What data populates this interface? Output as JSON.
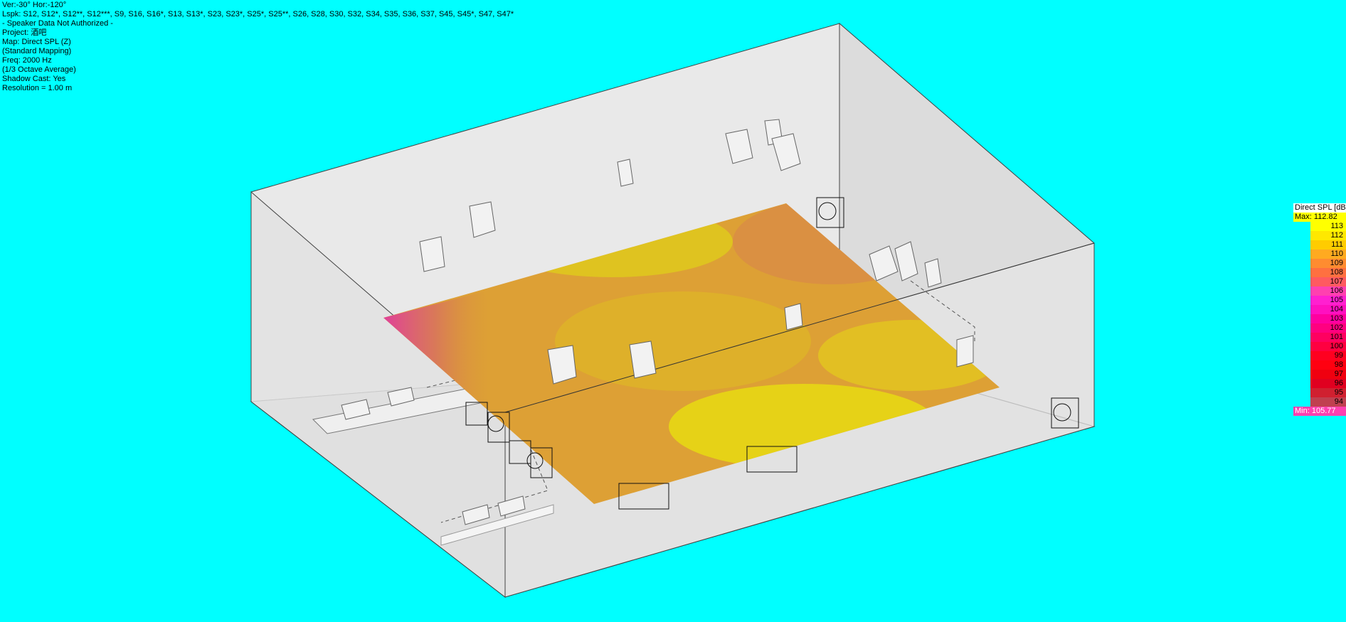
{
  "info": {
    "angles": "Ver:-30°   Hor:-120°",
    "loudspeakers": "Lspk: S12, S12*, S12**, S12***, S9, S16, S16*, S13, S13*, S23, S23*, S25*, S25**, S26, S28, S30, S32, S34, S35, S36, S37, S45, S45*, S47, S47*",
    "authorization": "- Speaker Data Not Authorized -",
    "project": "Project: 酒吧",
    "map": "Map: Direct SPL (Z)",
    "mapping": "(Standard Mapping)",
    "frequency": "Freq: 2000 Hz",
    "averaging": "(1/3 Octave Average)",
    "shadow": "Shadow Cast: Yes",
    "resolution": "Resolution =   1.00 m"
  },
  "legend": {
    "title": "Direct SPL [dB]",
    "max_label": "Max:  112.82",
    "min_label": "Min:  105.77",
    "levels": [
      {
        "value": "113",
        "color": "#FFFF00"
      },
      {
        "value": "112",
        "color": "#FFE800"
      },
      {
        "value": "111",
        "color": "#FFCC00"
      },
      {
        "value": "110",
        "color": "#FFAA20"
      },
      {
        "value": "109",
        "color": "#FF8C30"
      },
      {
        "value": "108",
        "color": "#FF7040"
      },
      {
        "value": "107",
        "color": "#FF5A60"
      },
      {
        "value": "106",
        "color": "#FF40B0"
      },
      {
        "value": "105",
        "color": "#FF20D0"
      },
      {
        "value": "104",
        "color": "#FF10C0"
      },
      {
        "value": "103",
        "color": "#FF00A0"
      },
      {
        "value": "102",
        "color": "#FF0080"
      },
      {
        "value": "101",
        "color": "#FF0060"
      },
      {
        "value": "100",
        "color": "#FF0040"
      },
      {
        "value": "99",
        "color": "#FF0020"
      },
      {
        "value": "98",
        "color": "#FF0010"
      },
      {
        "value": "97",
        "color": "#F00010"
      },
      {
        "value": "96",
        "color": "#E00020"
      },
      {
        "value": "95",
        "color": "#D02030"
      },
      {
        "value": "94",
        "color": "#C04050"
      }
    ]
  }
}
